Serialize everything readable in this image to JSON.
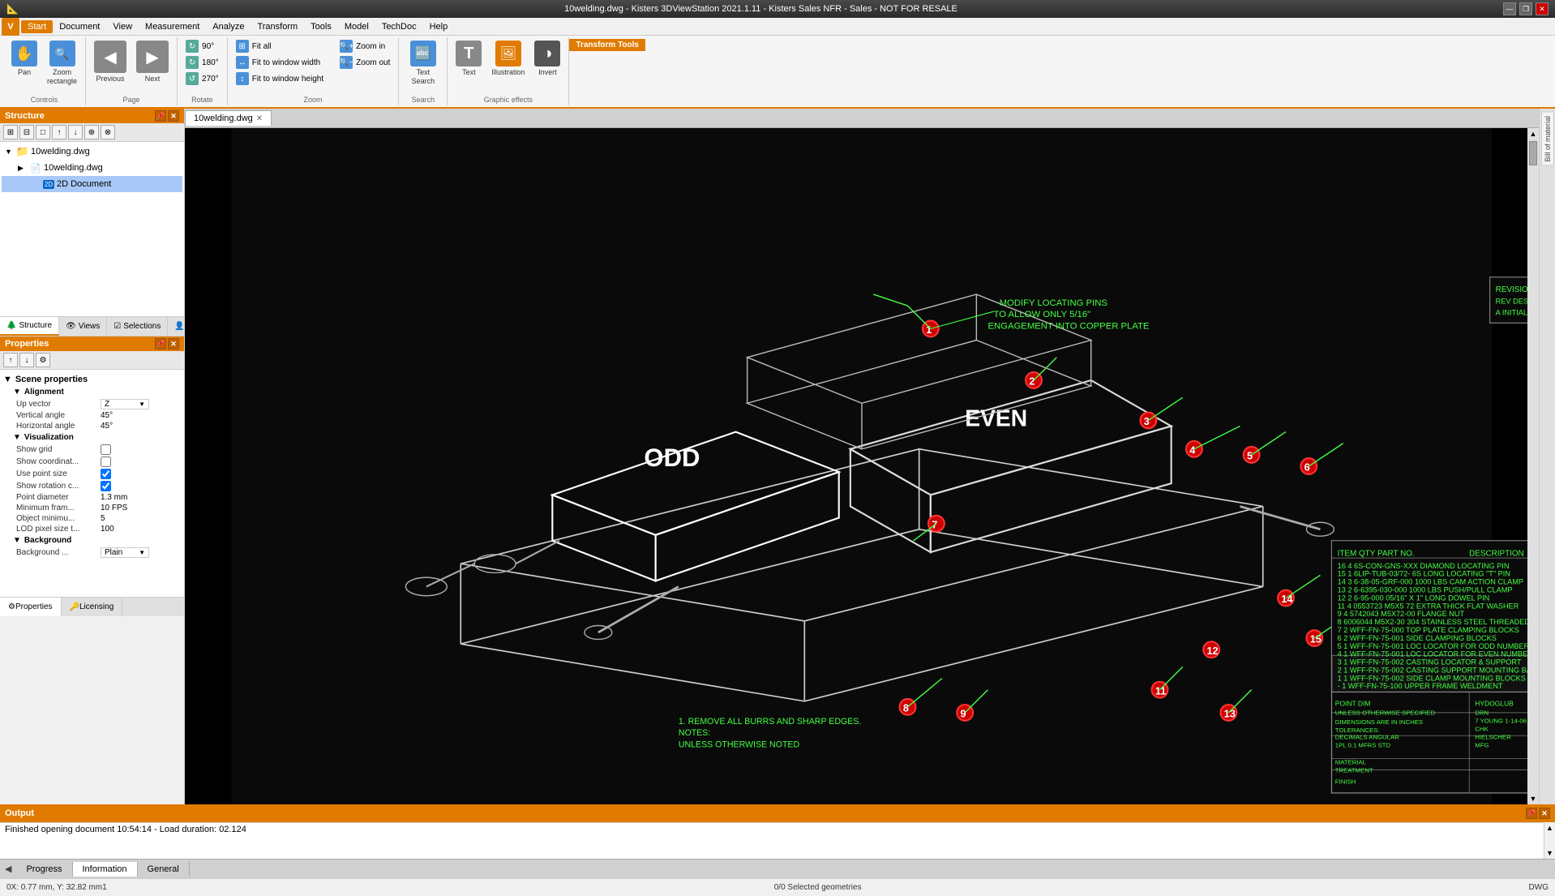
{
  "titlebar": {
    "title": "10welding.dwg - Kisters 3DViewStation 2021.1.11 - Kisters Sales NFR - Sales - NOT FOR RESALE",
    "min_btn": "—",
    "max_btn": "❐",
    "close_btn": "✕"
  },
  "menubar": {
    "v_label": "V",
    "items": [
      "Start",
      "Document",
      "View",
      "Measurement",
      "Analyze",
      "Transform",
      "Tools",
      "Model",
      "TechDoc",
      "Help"
    ]
  },
  "ribbon": {
    "groups": [
      {
        "label": "Controls",
        "buttons": [
          {
            "id": "pan",
            "label": "Pan",
            "icon": "✋"
          },
          {
            "id": "zoom-rect",
            "label": "Zoom\nrectangle",
            "icon": "🔍"
          }
        ]
      },
      {
        "label": "Page",
        "buttons": [
          {
            "id": "previous",
            "label": "Previous",
            "icon": "◀"
          },
          {
            "id": "next",
            "label": "Next",
            "icon": "▶"
          }
        ]
      },
      {
        "label": "Rotate",
        "small_buttons": [
          {
            "id": "rot90",
            "label": "90°",
            "icon": "↻"
          },
          {
            "id": "rot180",
            "label": "180°",
            "icon": "↻"
          },
          {
            "id": "rot270",
            "label": "270°",
            "icon": "↺"
          }
        ]
      },
      {
        "label": "Zoom",
        "small_buttons": [
          {
            "id": "fit-all",
            "label": "Fit all",
            "icon": "⊞"
          },
          {
            "id": "fit-width",
            "label": "Fit to window width",
            "icon": "↔"
          },
          {
            "id": "fit-height",
            "label": "Fit to window height",
            "icon": "↕"
          },
          {
            "id": "zoom-in",
            "label": "Zoom in",
            "icon": "+"
          },
          {
            "id": "zoom-out",
            "label": "Zoom out",
            "icon": "−"
          }
        ]
      },
      {
        "label": "Search",
        "buttons": [
          {
            "id": "text-search",
            "label": "Text\nSearch",
            "icon": "🔤"
          }
        ]
      },
      {
        "label": "Graphic effects",
        "buttons": [
          {
            "id": "text",
            "label": "Text",
            "icon": "T"
          },
          {
            "id": "illustration",
            "label": "Illustration",
            "icon": "🖼"
          },
          {
            "id": "invert",
            "label": "Invert",
            "icon": "◑"
          }
        ]
      }
    ],
    "transform_tools_label": "Transform Tools"
  },
  "structure_panel": {
    "title": "Structure",
    "toolbar_btns": [
      "+",
      "−",
      "□",
      "↑",
      "↓",
      "⊞",
      "⊟"
    ],
    "tree": [
      {
        "id": "node1",
        "label": "10welding.dwg",
        "level": 0,
        "expanded": true,
        "type": "folder"
      },
      {
        "id": "node2",
        "label": "10welding.dwg",
        "level": 1,
        "expanded": false,
        "type": "doc"
      },
      {
        "id": "node3",
        "label": "2D Document",
        "level": 2,
        "selected": true,
        "type": "2d"
      }
    ],
    "tabs": [
      {
        "id": "structure",
        "label": "Structure",
        "active": true
      },
      {
        "id": "views",
        "label": "Views"
      },
      {
        "id": "selections",
        "label": "Selections"
      },
      {
        "id": "profiles",
        "label": "Profiles"
      }
    ]
  },
  "properties_panel": {
    "title": "Properties",
    "toolbar_btns": [
      "↑",
      "↓",
      "⚙"
    ],
    "sections": [
      {
        "id": "scene-properties",
        "label": "Scene properties",
        "expanded": true,
        "subsections": [
          {
            "id": "alignment",
            "label": "Alignment",
            "expanded": true,
            "rows": [
              {
                "label": "Up vector",
                "value": "Z",
                "type": "dropdown"
              },
              {
                "label": "Vertical angle",
                "value": "45°",
                "type": "text"
              },
              {
                "label": "Horizontal angle",
                "value": "45°",
                "type": "text"
              }
            ]
          },
          {
            "id": "visualization",
            "label": "Visualization",
            "expanded": true,
            "rows": [
              {
                "label": "Show grid",
                "value": false,
                "type": "checkbox"
              },
              {
                "label": "Show coordinat...",
                "value": false,
                "type": "checkbox"
              },
              {
                "label": "Use point size",
                "value": true,
                "type": "checkbox"
              },
              {
                "label": "Show rotation c...",
                "value": true,
                "type": "checkbox"
              },
              {
                "label": "Point diameter",
                "value": "1.3 mm",
                "type": "text"
              },
              {
                "label": "Minimum fram...",
                "value": "10 FPS",
                "type": "text"
              },
              {
                "label": "Object minimu...",
                "value": "5",
                "type": "text"
              },
              {
                "label": "LOD pixel size t...",
                "value": "100",
                "type": "text"
              }
            ]
          },
          {
            "id": "background",
            "label": "Background",
            "expanded": true,
            "rows": [
              {
                "label": "Background ...",
                "value": "Plain",
                "type": "dropdown"
              }
            ]
          }
        ]
      }
    ],
    "tabs": [
      {
        "id": "properties",
        "label": "Properties",
        "active": true
      },
      {
        "id": "licensing",
        "label": "Licensing"
      }
    ]
  },
  "doc_tabs": [
    {
      "id": "10welding",
      "label": "10welding.dwg",
      "active": true,
      "closable": true
    }
  ],
  "output": {
    "title": "Output",
    "message": "Finished opening document 10:54:14 - Load duration: 02.124",
    "scroll_up": "▲",
    "scroll_down": "▼"
  },
  "bottom_tabs": {
    "nav_prev": "◀",
    "tabs": [
      {
        "id": "progress",
        "label": "Progress"
      },
      {
        "id": "information",
        "label": "Information",
        "active": true
      },
      {
        "id": "general",
        "label": "General"
      }
    ]
  },
  "status_bar": {
    "coords": "0X: 0.77 mm, Y: 32.82 mm1",
    "selection": "0/0 Selected geometries",
    "format": "DWG"
  },
  "right_panel": {
    "btn": "Bill of material"
  },
  "viewport": {
    "drawing_desc": "Upper frame assembly 3D perspective view - welding drawing"
  }
}
